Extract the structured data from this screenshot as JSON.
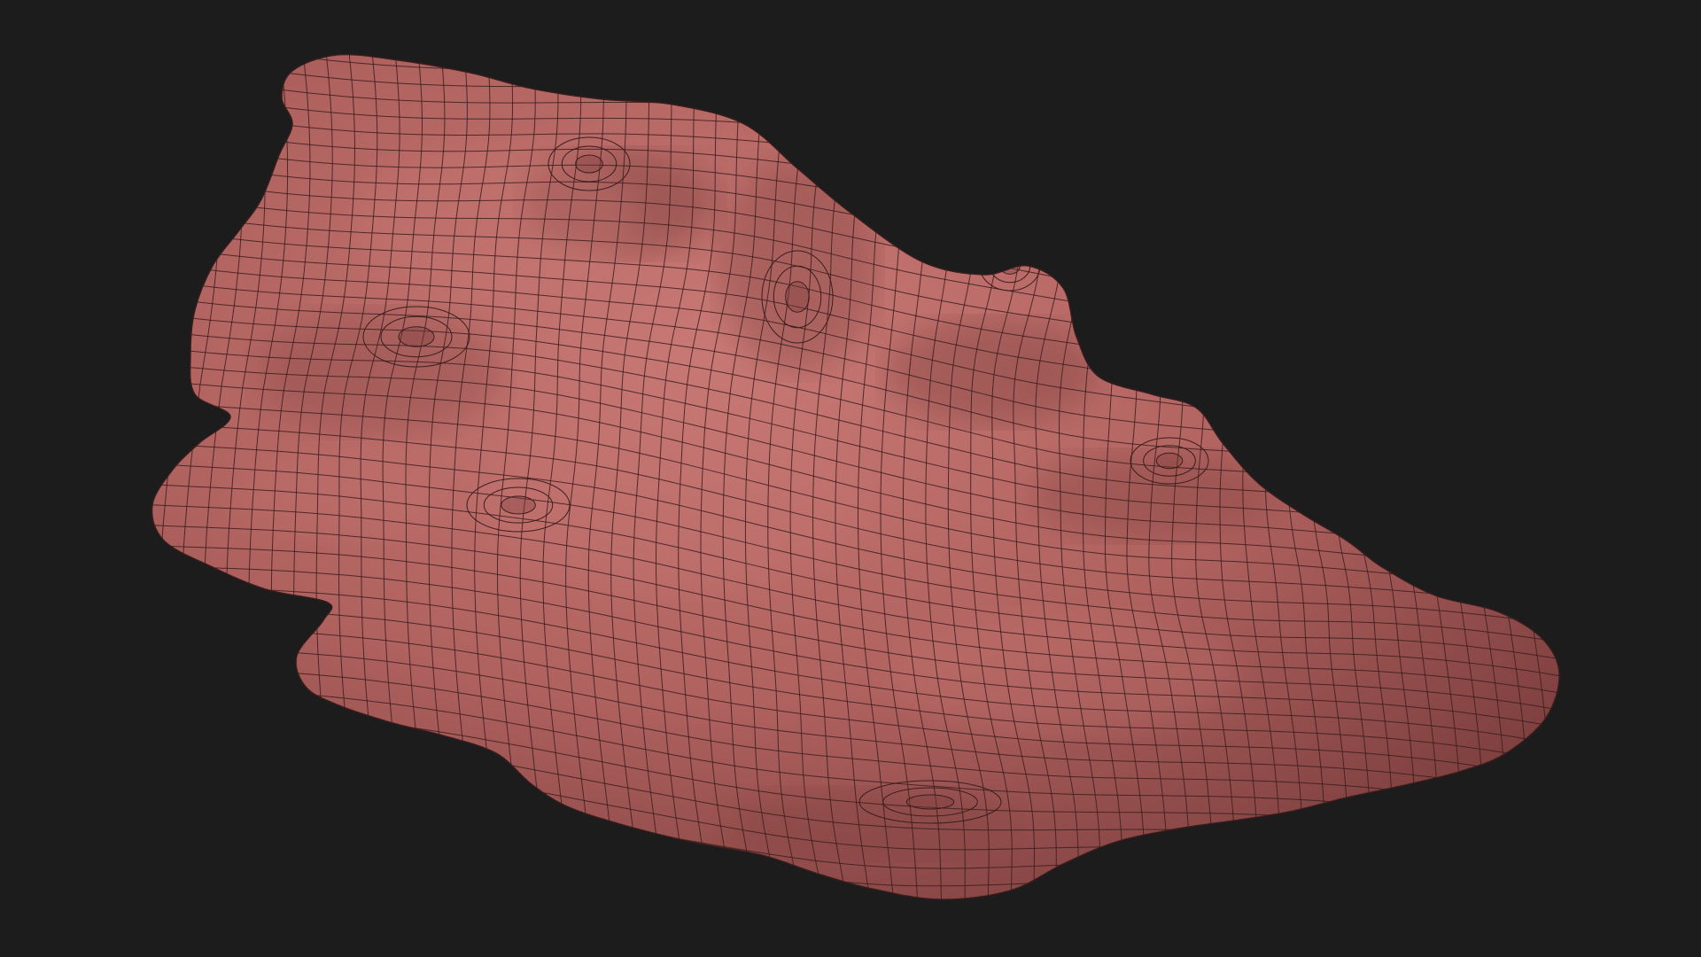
{
  "scene": {
    "background_color": "#1c1c1c",
    "subject": "wireframe-sculpted-mesh",
    "mesh": {
      "fill_color": "#b0625f",
      "highlight_color": "#c97975",
      "shadow_color": "#7d3f3e",
      "wire_color": "#3a1d1d",
      "display_mode": "shaded-with-wireframe",
      "topology": "quad"
    }
  }
}
